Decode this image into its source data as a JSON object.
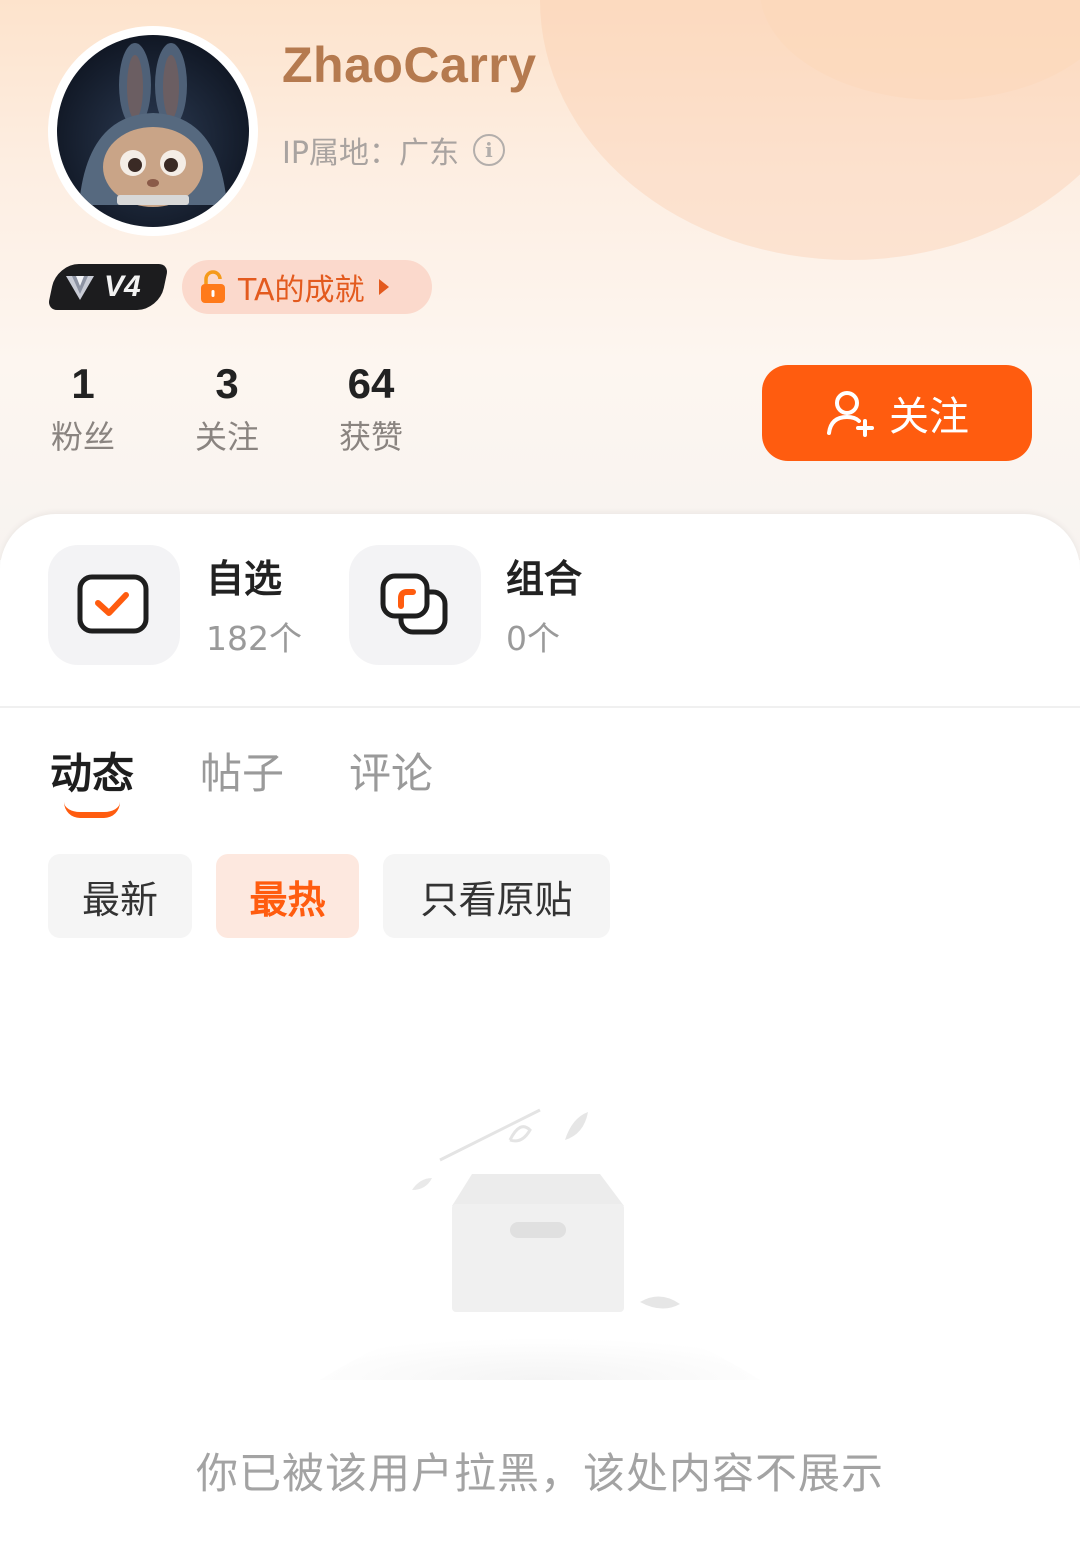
{
  "profile": {
    "username": "ZhaoCarry",
    "ip_location": "IP属地：广东",
    "level": "V4",
    "achievement_label": "TA的成就"
  },
  "stats": [
    {
      "value": "1",
      "label": "粉丝"
    },
    {
      "value": "3",
      "label": "关注"
    },
    {
      "value": "64",
      "label": "获赞"
    }
  ],
  "follow_button": {
    "label": "关注"
  },
  "watchlists": [
    {
      "title": "自选",
      "count": "182个",
      "icon": "checkbox-icon"
    },
    {
      "title": "组合",
      "count": "0个",
      "icon": "portfolio-icon"
    }
  ],
  "tabs": [
    {
      "label": "动态",
      "active": true
    },
    {
      "label": "帖子",
      "active": false
    },
    {
      "label": "评论",
      "active": false
    }
  ],
  "filters": [
    {
      "label": "最新",
      "active": false
    },
    {
      "label": "最热",
      "active": true
    },
    {
      "label": "只看原贴",
      "active": false
    }
  ],
  "empty_state": {
    "message": "你已被该用户拉黑，该处内容不展示",
    "icon": "empty-box-icon"
  },
  "colors": {
    "accent": "#ff5c0f",
    "username": "#b57a4f",
    "achievement_bg": "#fbd9cc"
  }
}
